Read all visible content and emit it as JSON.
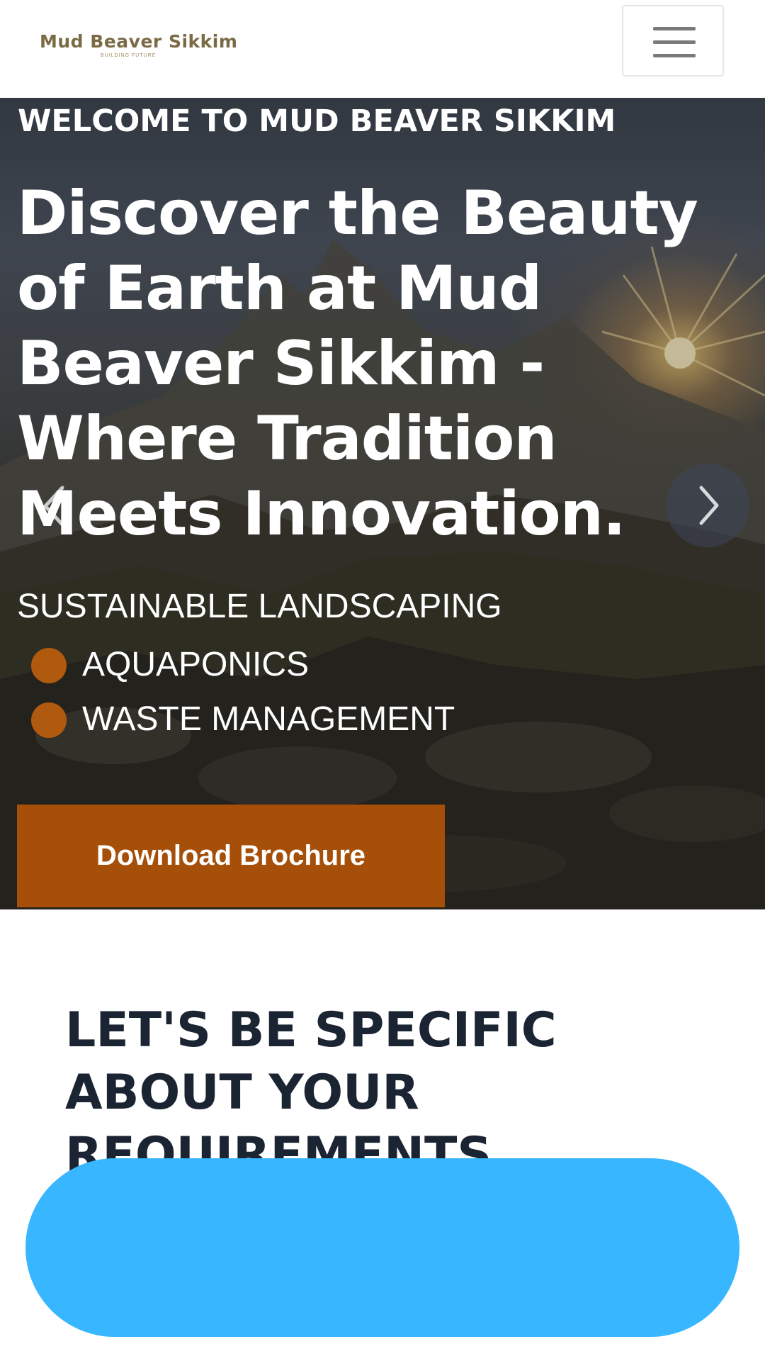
{
  "header": {
    "logo_title": "Mud Beaver Sikkim",
    "logo_tagline": "BUILDING FUTURE",
    "menu_icon": "hamburger-menu-icon"
  },
  "hero": {
    "eyebrow": "WELCOME TO MUD BEAVER SIKKIM",
    "headline": "Discover the Beauty of Earth at Mud Beaver Sikkim - Where Tradition Meets Innovation.",
    "services_title": "SUSTAINABLE LANDSCAPING",
    "services": [
      "AQUAPONICS",
      "WASTE MANAGEMENT"
    ],
    "download_label": "Download Brochure",
    "prev_icon": "chevron-left-icon",
    "next_icon": "chevron-right-icon"
  },
  "requirements": {
    "title": "LET'S BE SPECIFIC ABOUT YOUR REQUIREMENTS"
  },
  "colors": {
    "accent_brown": "#a54f08",
    "bullet_brown": "#b05a0f",
    "cta_blue": "#38b6ff",
    "heading_dark": "#1b2432"
  }
}
